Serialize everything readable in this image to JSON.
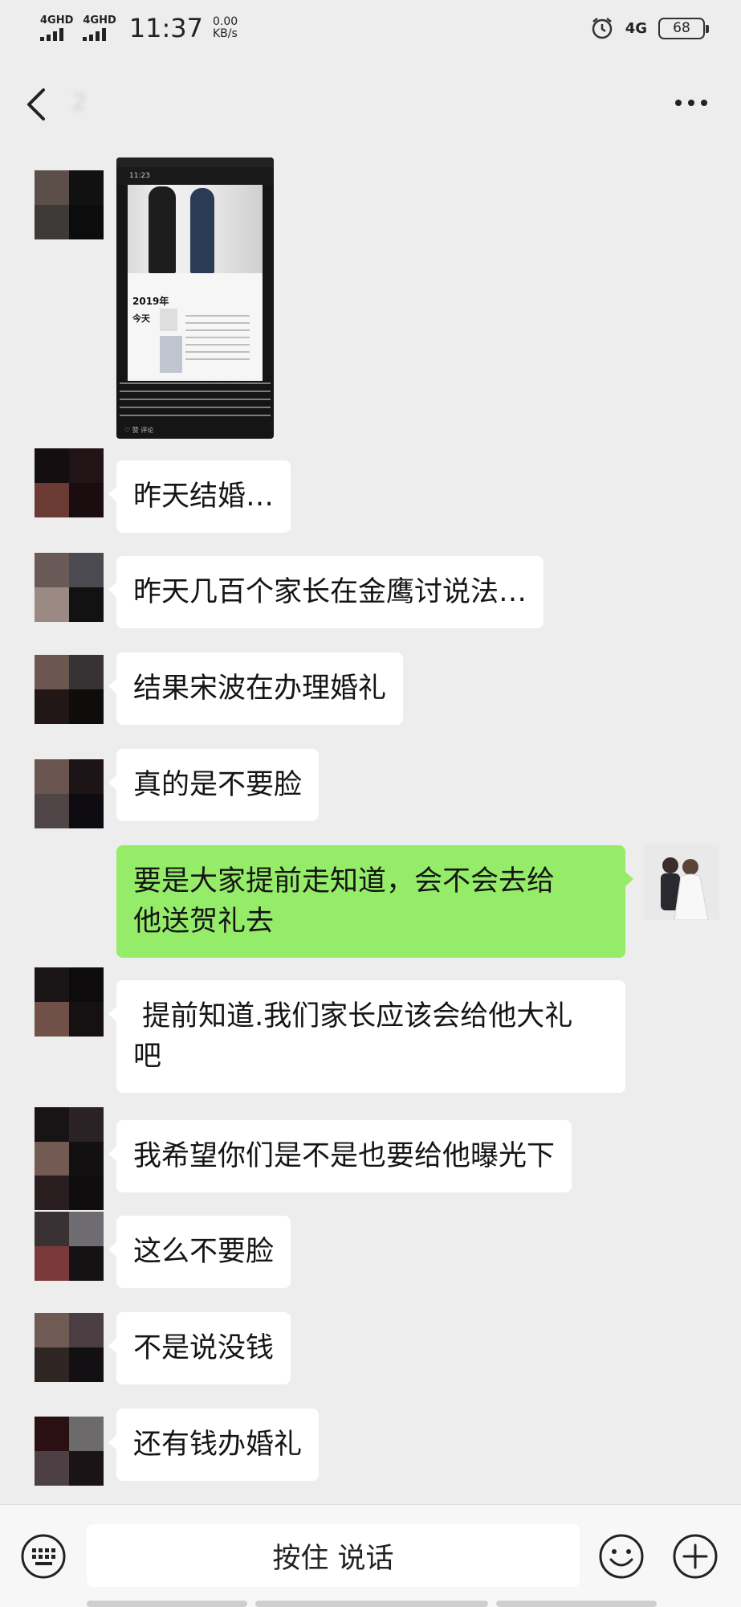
{
  "status_bar": {
    "sim1": "4GHD",
    "sim2": "4GHD",
    "time": "11:37",
    "speed_value": "0.00",
    "speed_unit": "KB/s",
    "network": "4G",
    "battery": "68",
    "icons": [
      "signal-icon",
      "alarm-icon",
      "battery-icon"
    ]
  },
  "header": {
    "title": "2",
    "back_icon": "chevron-left-icon",
    "more_icon": "more-dots-icon"
  },
  "image_message": {
    "time": "11:23",
    "year": "2019年",
    "today": "今天",
    "footer": "♡ 赞    评论"
  },
  "messages": [
    {
      "id": "m1",
      "side": "left",
      "text": "昨天结婚…"
    },
    {
      "id": "m2",
      "side": "left",
      "text": "昨天几百个家长在金鹰讨说法…"
    },
    {
      "id": "m3",
      "side": "left",
      "text": "结果宋波在办理婚礼"
    },
    {
      "id": "m4",
      "side": "left",
      "text": "真的是不要脸"
    },
    {
      "id": "m5",
      "side": "right",
      "line1": "要是大家提前走知道，会不会去给",
      "line2": "他送贺礼去"
    },
    {
      "id": "m6",
      "side": "left",
      "line1": " 提前知道.我们家长应该会给他大礼",
      "line2": "吧"
    },
    {
      "id": "m7",
      "side": "left",
      "text": "我希望你们是不是也要给他曝光下"
    },
    {
      "id": "m8",
      "side": "left",
      "text": "这么不要脸"
    },
    {
      "id": "m9",
      "side": "left",
      "text": "不是说没钱"
    },
    {
      "id": "m10",
      "side": "left",
      "text": "还有钱办婚礼"
    }
  ],
  "input_bar": {
    "hold_to_talk": "按住 说话",
    "icons": [
      "keyboard-icon",
      "emoji-icon",
      "plus-icon"
    ]
  }
}
